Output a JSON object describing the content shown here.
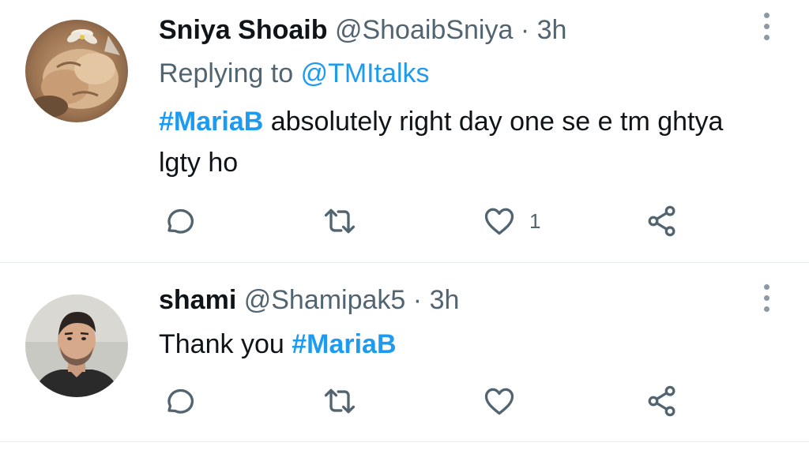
{
  "tweets": [
    {
      "display_name": "Sniya Shoaib",
      "handle": "@ShoaibSniya",
      "separator": "·",
      "time": "3h",
      "replying_prefix": "Replying to",
      "replying_to": "@TMItalks",
      "hashtag": "#MariaB",
      "text_after_hashtag": " absolutely right day one se e tm ghtya lgty ho",
      "like_count": "1",
      "avatar_icon": "cat-avatar"
    },
    {
      "display_name": "shami",
      "handle": "@Shamipak5",
      "separator": "·",
      "time": "3h",
      "text_before_hashtag": "Thank you ",
      "hashtag": "#MariaB",
      "avatar_icon": "man-avatar"
    }
  ],
  "icons": {
    "reply": "reply-icon",
    "retweet": "retweet-icon",
    "like": "heart-icon",
    "share": "share-icon",
    "more": "more-options-icon"
  },
  "colors": {
    "link": "#1d9bf0",
    "secondary_text": "#536471",
    "primary_text": "#0f1419",
    "icon": "#536471",
    "divider": "#e6ecf0"
  }
}
